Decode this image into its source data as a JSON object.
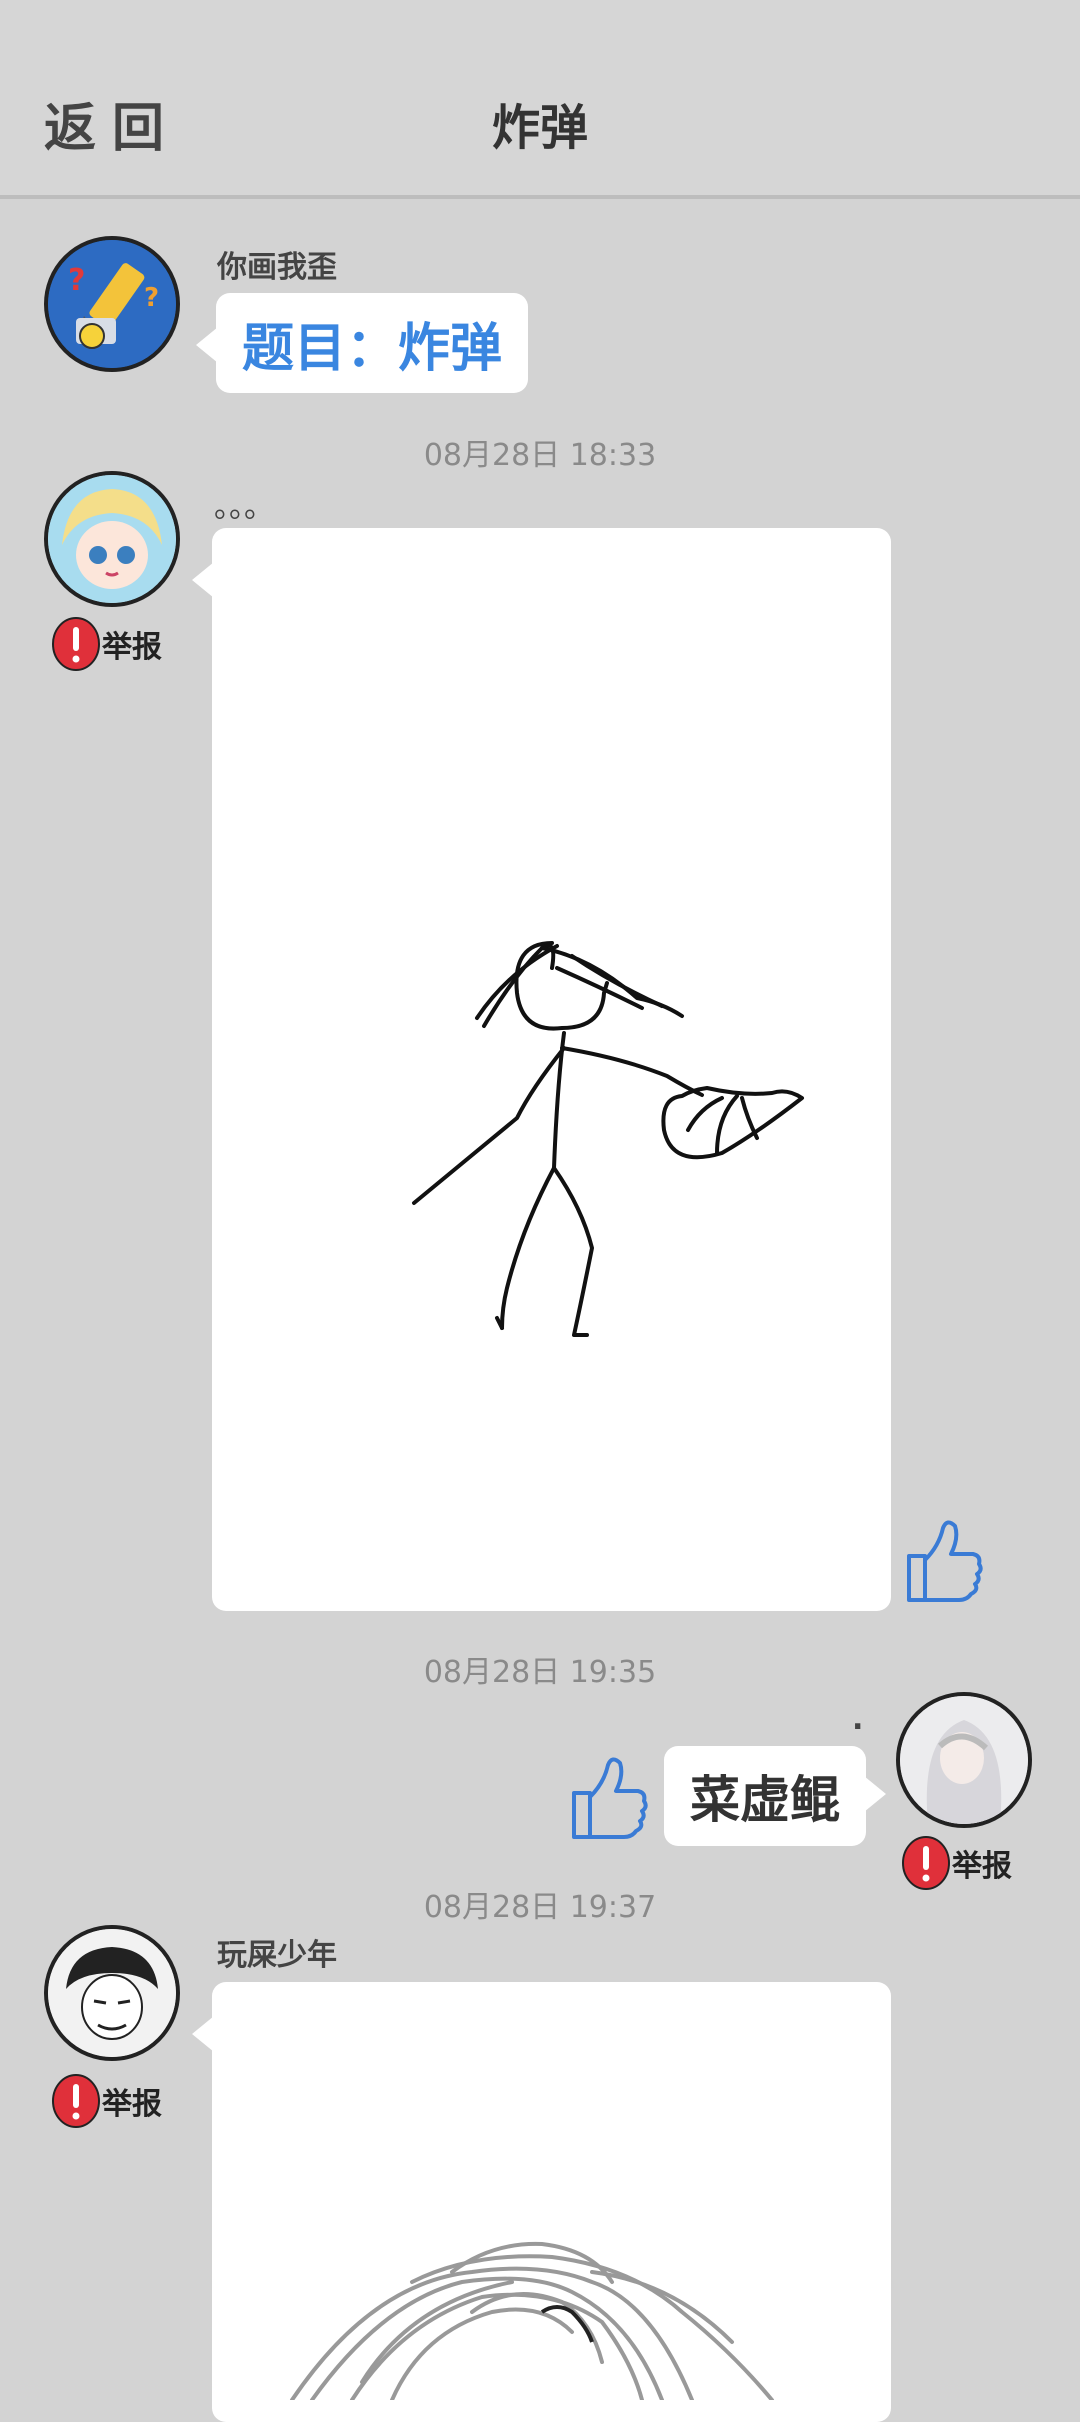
{
  "header": {
    "back_label": "返回",
    "title": "炸弹"
  },
  "messages": {
    "host": {
      "name": "你画我歪",
      "text": "题目：炸弹"
    },
    "time1": "08月28日  18:33",
    "drawing1": {
      "caption": "。。。",
      "report": "举报"
    },
    "time2": "08月28日  19:35",
    "guess": {
      "dot": ".",
      "text": "菜虚鲲",
      "report": "举报"
    },
    "time3": "08月28日  19:37",
    "drawing2": {
      "name": "玩屎少年",
      "report": "举报"
    }
  },
  "colors": {
    "accent": "#3a86e0",
    "report": "#e0303a",
    "background": "#d3d3d3"
  }
}
